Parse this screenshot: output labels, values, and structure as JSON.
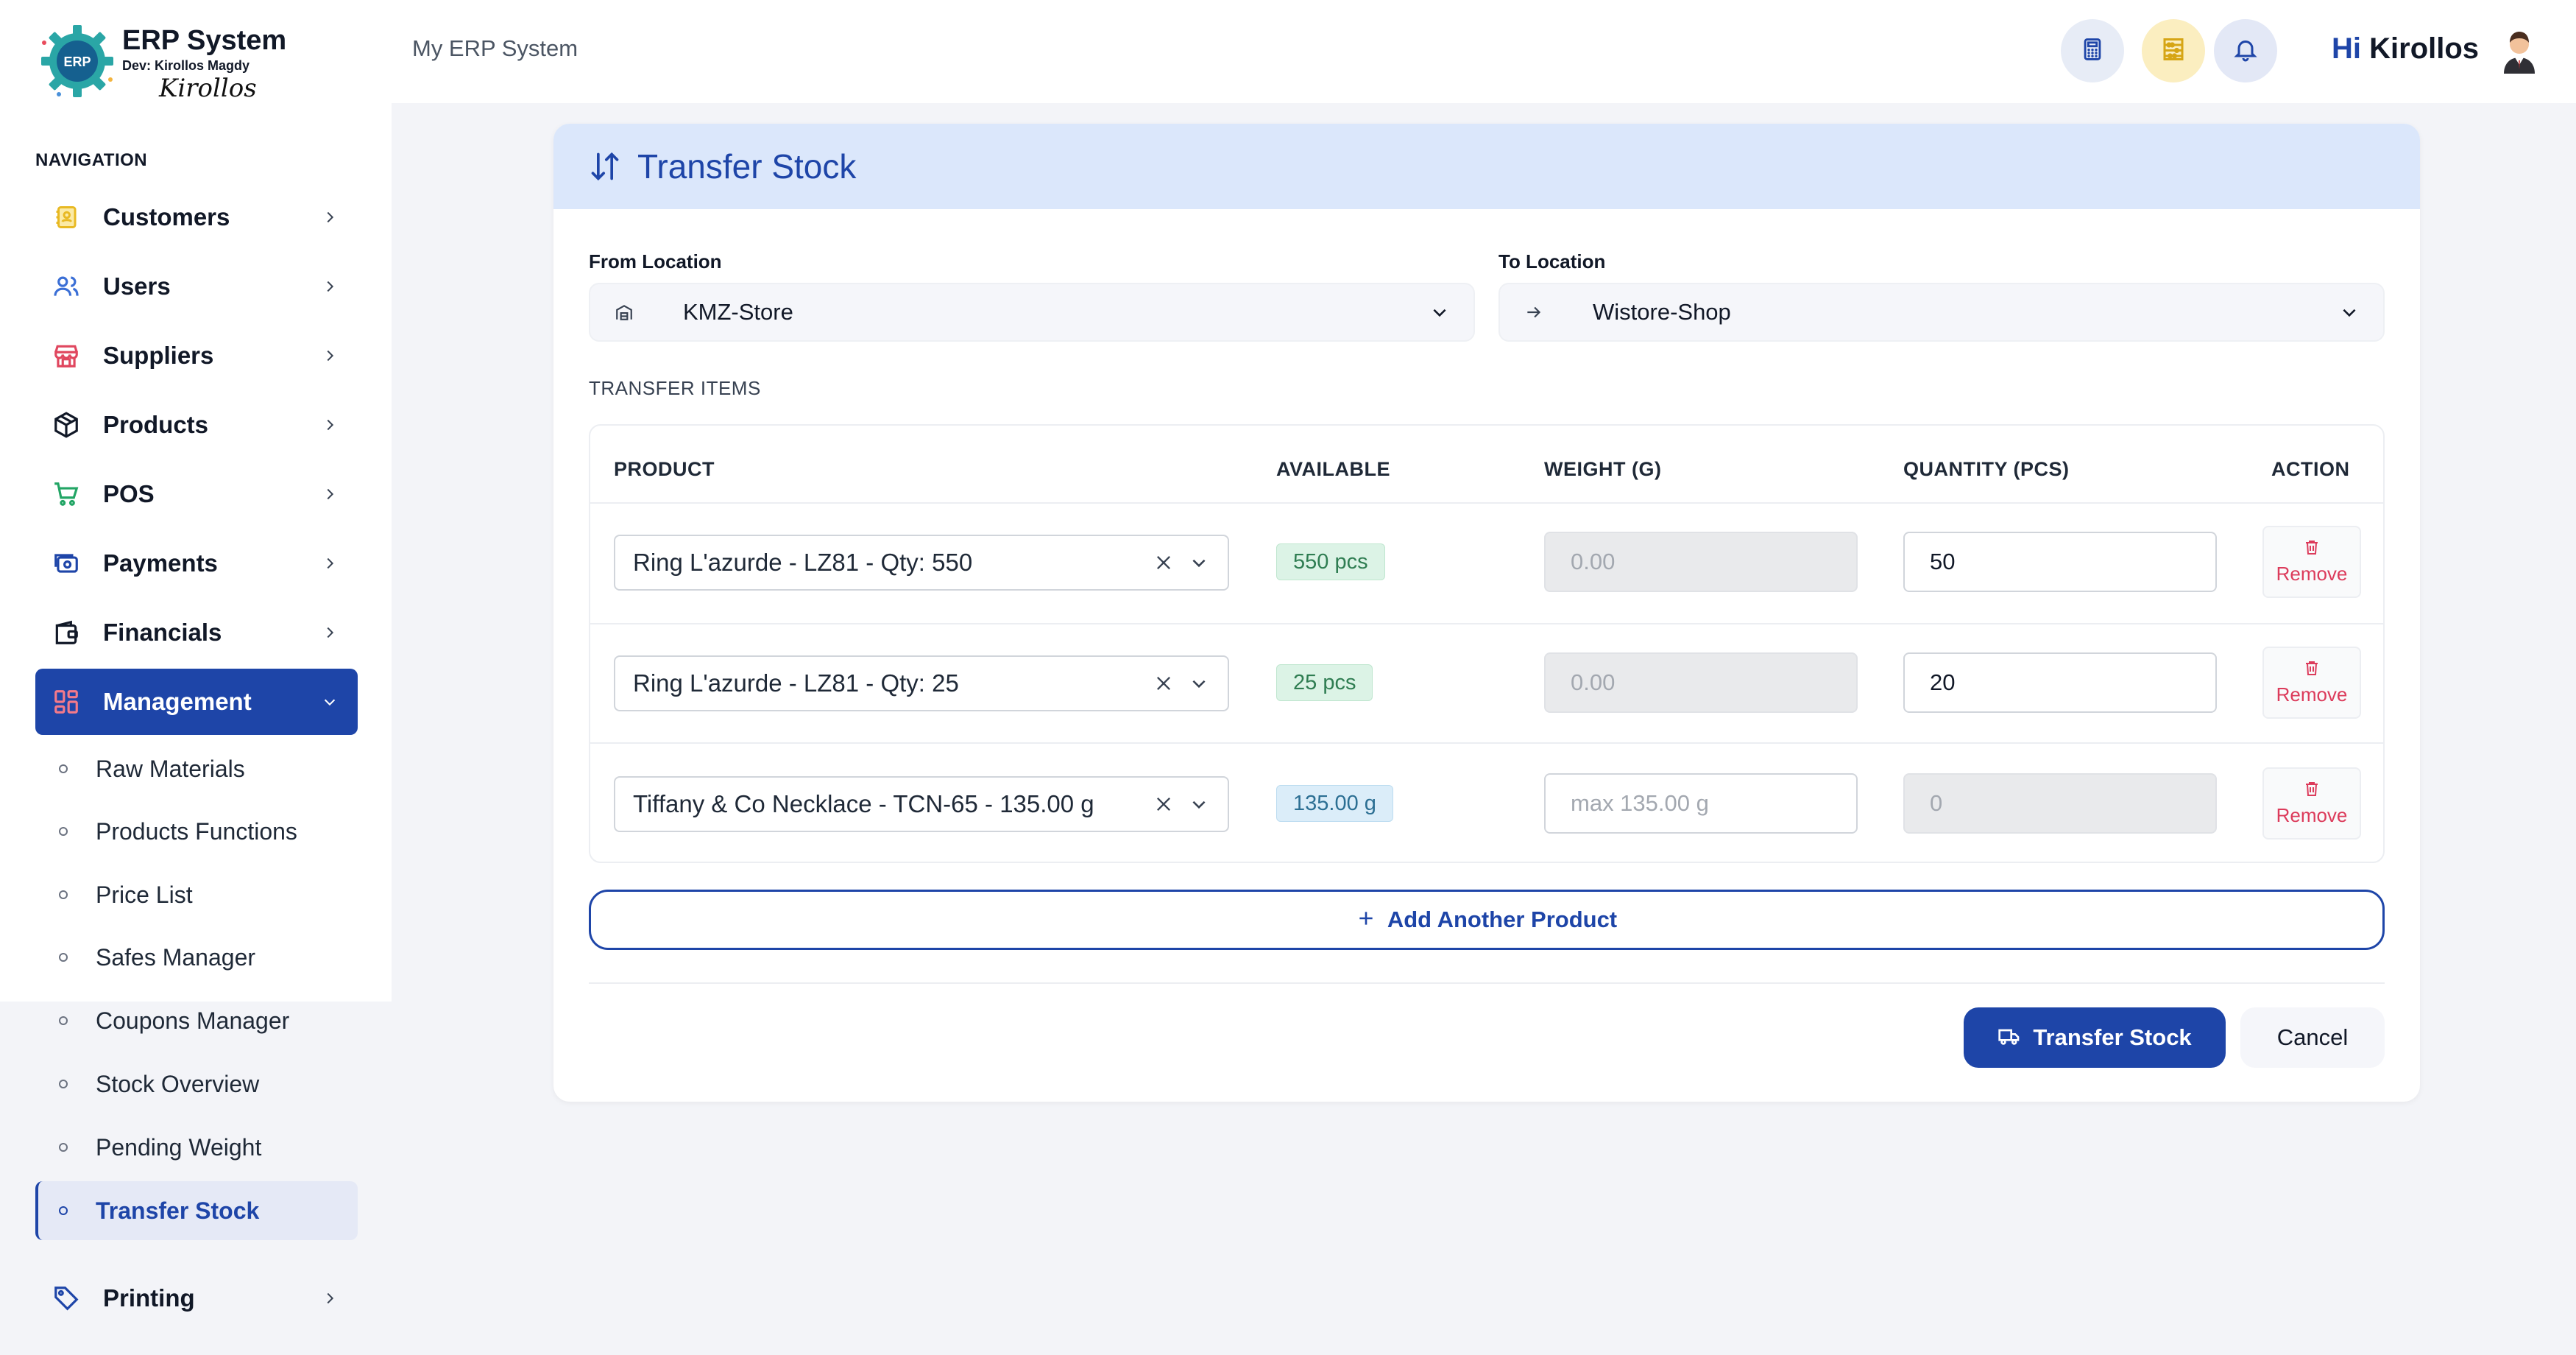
{
  "brand": {
    "title": "ERP System",
    "dev": "Dev: Kirollos Magdy",
    "signature": "Kirollos",
    "logo_text": "ERP"
  },
  "sidebar": {
    "heading": "NAVIGATION",
    "items": [
      {
        "label": "Customers",
        "icon": "address-book-icon"
      },
      {
        "label": "Users",
        "icon": "users-icon"
      },
      {
        "label": "Suppliers",
        "icon": "store-icon"
      },
      {
        "label": "Products",
        "icon": "box-icon"
      },
      {
        "label": "POS",
        "icon": "cart-icon"
      },
      {
        "label": "Payments",
        "icon": "money-icon"
      },
      {
        "label": "Financials",
        "icon": "wallet-icon"
      },
      {
        "label": "Management",
        "icon": "grid-icon"
      },
      {
        "label": "Printing",
        "icon": "tag-icon"
      }
    ],
    "management_sub": [
      "Raw Materials",
      "Products Functions",
      "Price List",
      "Safes Manager",
      "Coupons Manager",
      "Stock Overview",
      "Pending Weight",
      "Transfer Stock"
    ]
  },
  "topbar": {
    "title": "My ERP System",
    "greeting_word": "Hi",
    "user_name": "Kirollos"
  },
  "card": {
    "title": "Transfer Stock",
    "from_label": "From Location",
    "from_value": "KMZ-Store",
    "to_label": "To Location",
    "to_value": "Wistore-Shop",
    "items_label": "TRANSFER ITEMS",
    "columns": [
      "PRODUCT",
      "AVAILABLE",
      "WEIGHT (G)",
      "QUANTITY (PCS)",
      "ACTION"
    ],
    "rows": [
      {
        "product": "Ring L'azurde - LZ81 - Qty: 550",
        "available": "550 pcs",
        "weight": "0.00",
        "quantity": "50",
        "action": "Remove"
      },
      {
        "product": "Ring L'azurde - LZ81 - Qty: 25",
        "available": "25 pcs",
        "weight": "0.00",
        "quantity": "20",
        "action": "Remove"
      },
      {
        "product": "Tiffany & Co Necklace - TCN-65 - 135.00 g",
        "available": "135.00 g",
        "weight_placeholder": "max 135.00 g",
        "quantity": "0",
        "action": "Remove"
      }
    ],
    "add_label": "Add Another Product",
    "submit_label": "Transfer Stock",
    "cancel_label": "Cancel"
  },
  "colors": {
    "primary": "#1e45a8",
    "header_bg": "#dbe7fb",
    "danger": "#dc3b5b"
  }
}
